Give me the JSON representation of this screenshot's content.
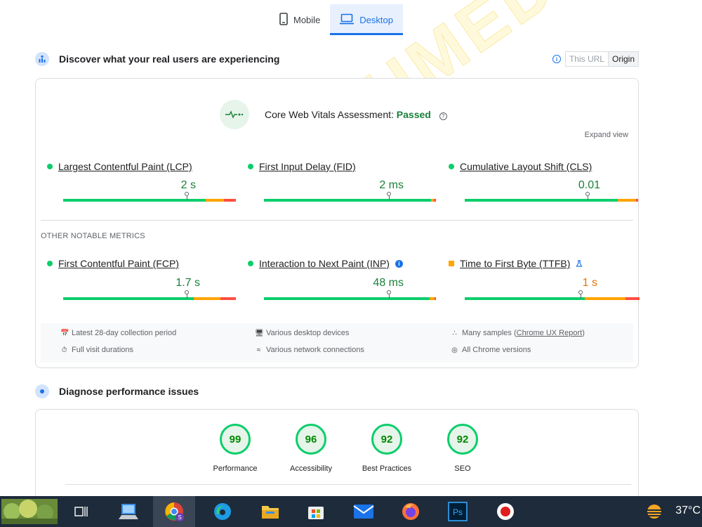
{
  "tabs": {
    "mobile": "Mobile",
    "desktop": "Desktop"
  },
  "real_users": {
    "heading": "Discover what your real users are experiencing",
    "toggle": {
      "this_url": "This URL",
      "origin": "Origin"
    },
    "assessment_label": "Core Web Vitals Assessment:",
    "assessment_status": "Passed",
    "expand": "Expand view",
    "core_metrics": [
      {
        "name": "Largest Contentful Paint (LCP)",
        "value": "2 s",
        "status": "good"
      },
      {
        "name": "First Input Delay (FID)",
        "value": "2 ms",
        "status": "good"
      },
      {
        "name": "Cumulative Layout Shift (CLS)",
        "value": "0.01",
        "status": "good"
      }
    ],
    "other_title": "OTHER NOTABLE METRICS",
    "other_metrics": [
      {
        "name": "First Contentful Paint (FCP)",
        "value": "1.7 s",
        "status": "good"
      },
      {
        "name": "Interaction to Next Paint (INP)",
        "value": "48 ms",
        "status": "good"
      },
      {
        "name": "Time to First Byte (TTFB)",
        "value": "1 s",
        "status": "needs-improvement"
      }
    ],
    "footer": {
      "period": "Latest 28-day collection period",
      "visits": "Full visit durations",
      "devices": "Various desktop devices",
      "network": "Various network connections",
      "samples_prefix": "Many samples (",
      "samples_link": "Chrome UX Report",
      "samples_suffix": ")",
      "versions": "All Chrome versions"
    }
  },
  "diagnose": {
    "heading": "Diagnose performance issues",
    "scores": [
      {
        "label": "Performance",
        "value": "99"
      },
      {
        "label": "Accessibility",
        "value": "96"
      },
      {
        "label": "Best Practices",
        "value": "92"
      },
      {
        "label": "SEO",
        "value": "92"
      }
    ]
  },
  "taskbar": {
    "temperature": "37°C"
  },
  "watermark": "SAAD AHMED TURK",
  "colors": {
    "good": "#0cce6b",
    "average": "#ffa400",
    "poor": "#ff4e42",
    "accent": "#1a73e8"
  }
}
